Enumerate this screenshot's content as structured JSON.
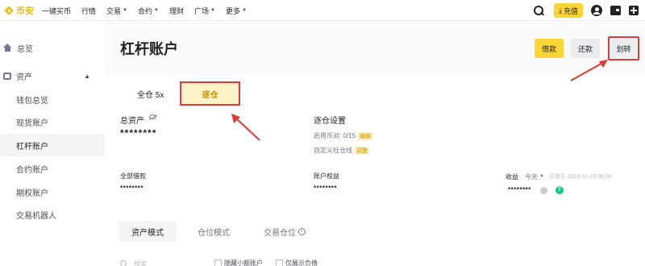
{
  "brand": {
    "name": "币安"
  },
  "nav": {
    "items": [
      {
        "label": "一键买币",
        "has_caret": false
      },
      {
        "label": "行情",
        "has_caret": false
      },
      {
        "label": "交易",
        "has_caret": true
      },
      {
        "label": "合约",
        "has_caret": true
      },
      {
        "label": "理财",
        "has_caret": false
      },
      {
        "label": "广场",
        "has_caret": true
      },
      {
        "label": "更多",
        "has_caret": true
      }
    ],
    "deposit_label": "充值"
  },
  "sidebar": {
    "overview": "总览",
    "assets": "资产",
    "items": [
      {
        "label": "钱包总览",
        "active": false
      },
      {
        "label": "现货账户",
        "active": false
      },
      {
        "label": "杠杆账户",
        "active": true
      },
      {
        "label": "合约账户",
        "active": false
      },
      {
        "label": "期权账户",
        "active": false
      },
      {
        "label": "交易机器人",
        "active": false
      }
    ]
  },
  "header": {
    "title": "杠杆账户",
    "borrow_label": "借款",
    "repay_label": "还款",
    "transfer_label": "划转"
  },
  "mode_tabs": {
    "cross": "全仓 5x",
    "isolated": "逐仓"
  },
  "summary": {
    "total_assets_label": "总资产",
    "total_assets_value": "********",
    "isolated_settings_label": "逐仓设置",
    "enabled_pairs_label": "启用币对: 0/15",
    "enabled_pairs_action": "编辑",
    "custom_liquidation_label": "自定义杜仓线",
    "custom_liquidation_action": "调整",
    "total_debt_label": "全部借款",
    "total_debt_value": "********",
    "account_equity_label": "账户权益",
    "account_equity_value": "********",
    "pnl_label": "收益",
    "pnl_period": "今天",
    "pnl_since": "开始于 2023-11-29 08:00",
    "pnl_value": "********"
  },
  "sub_tabs": [
    {
      "label": "资产模式",
      "active": true
    },
    {
      "label": "仓位模式",
      "active": false
    },
    {
      "label": "交易仓位",
      "active": false
    }
  ],
  "filters": {
    "search_placeholder": "搜索",
    "hide_small_label": "隐藏小额账户",
    "show_debt_only_label": "仅展示负债"
  },
  "colors": {
    "accent": "#fcd535",
    "accent_text": "#c99400",
    "annotation": "#e53935",
    "positive": "#0ecb81"
  }
}
